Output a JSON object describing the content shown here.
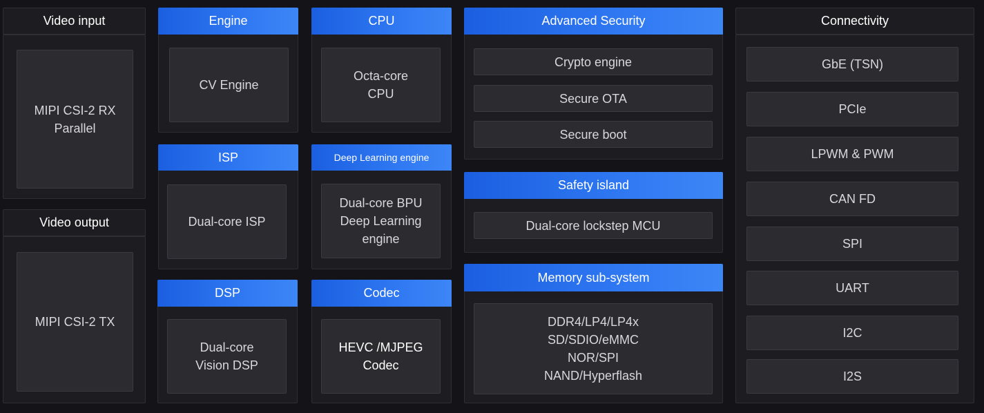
{
  "colors": {
    "background": "#141418",
    "panel": "#1d1d21",
    "box": "#2c2c30",
    "header_blue": "#2a6ff0"
  },
  "blocks": {
    "video_input": {
      "title": "Video input",
      "items": [
        "MIPI CSI-2 RX\nParallel"
      ]
    },
    "video_output": {
      "title": "Video output",
      "items": [
        "MIPI CSI-2 TX"
      ]
    },
    "engine": {
      "title": "Engine",
      "items": [
        "CV Engine"
      ]
    },
    "isp": {
      "title": "ISP",
      "items": [
        "Dual-core ISP"
      ]
    },
    "dsp": {
      "title": "DSP",
      "items": [
        "Dual-core\nVision DSP"
      ]
    },
    "cpu": {
      "title": "CPU",
      "items": [
        "Octa-core\nCPU"
      ]
    },
    "deep_learning": {
      "title": "Deep Learning engine",
      "items": [
        "Dual-core BPU\nDeep Learning\nengine"
      ]
    },
    "codec": {
      "title": "Codec",
      "items": [
        "HEVC /MJPEG\nCodec"
      ]
    },
    "advanced_security": {
      "title": "Advanced Security",
      "items": [
        "Crypto engine",
        "Secure OTA",
        "Secure boot"
      ]
    },
    "safety_island": {
      "title": "Safety island",
      "items": [
        "Dual-core lockstep MCU"
      ]
    },
    "memory": {
      "title": "Memory sub-system",
      "items": [
        "DDR4/LP4/LP4x\nSD/SDIO/eMMC\nNOR/SPI\nNAND/Hyperflash"
      ]
    },
    "connectivity": {
      "title": "Connectivity",
      "items": [
        "GbE (TSN)",
        "PCIe",
        "LPWM & PWM",
        "CAN FD",
        "SPI",
        "UART",
        "I2C",
        "I2S"
      ]
    }
  }
}
